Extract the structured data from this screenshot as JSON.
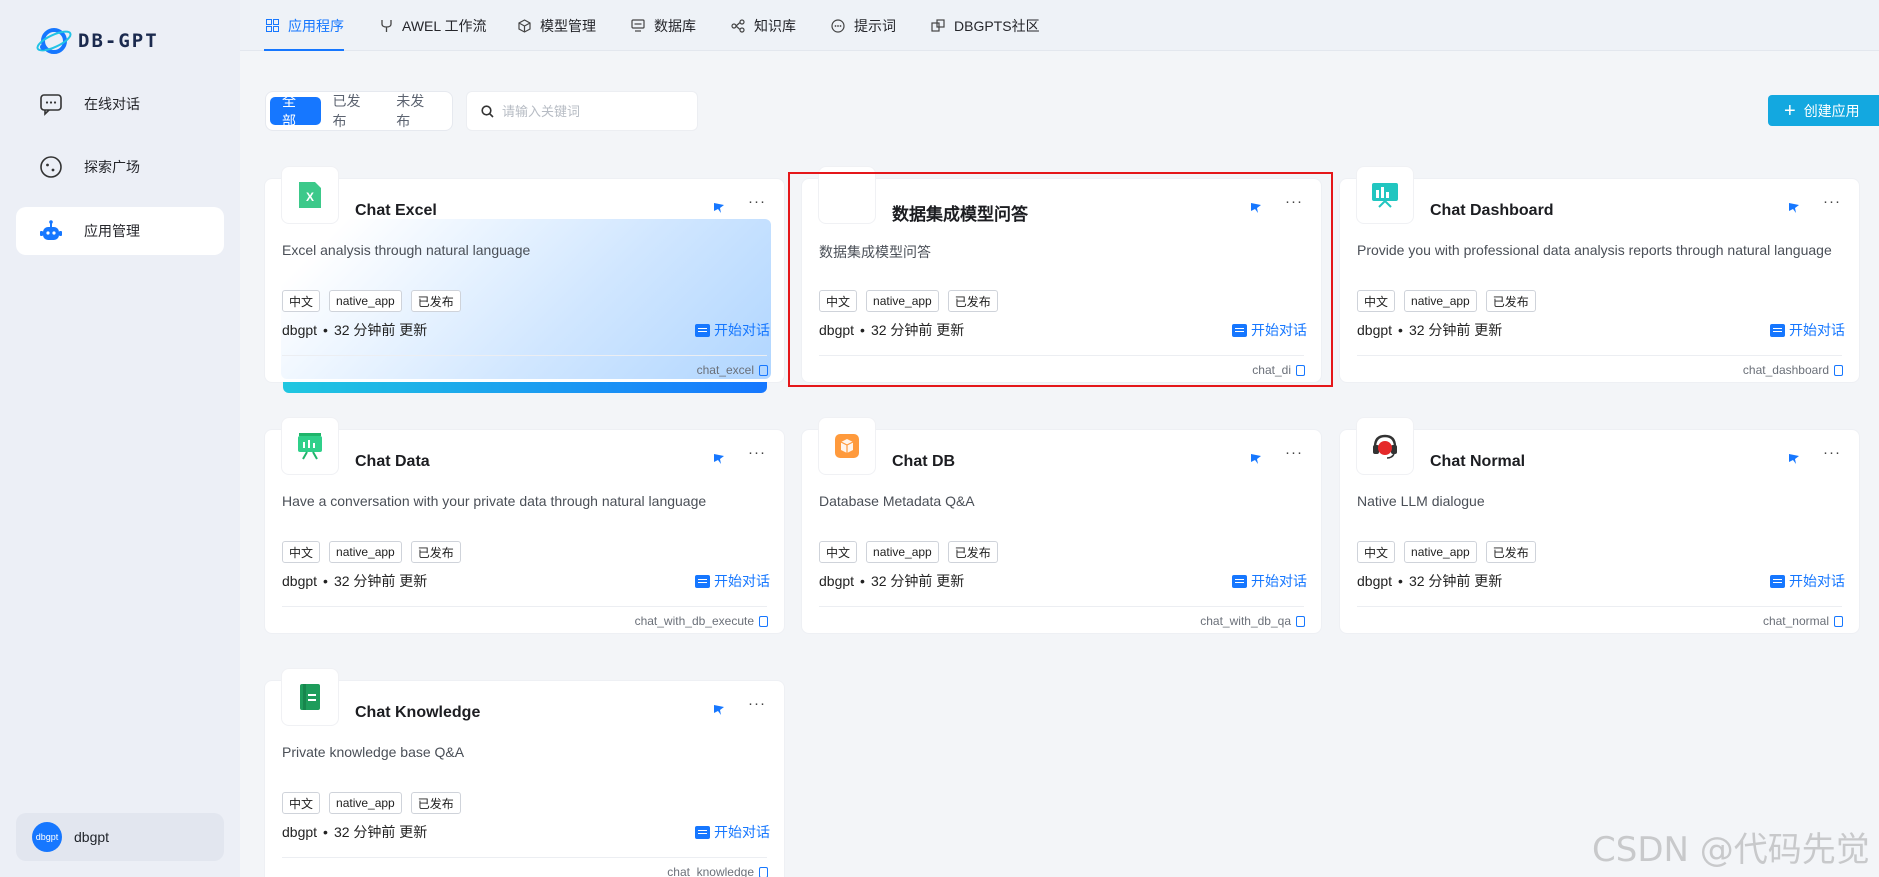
{
  "app": {
    "logo_text": "DB-GPT"
  },
  "sidebar": {
    "items": [
      {
        "label": "在线对话",
        "icon": "chat-bubble-icon"
      },
      {
        "label": "探索广场",
        "icon": "compass-icon"
      },
      {
        "label": "应用管理",
        "icon": "robot-icon",
        "active": true
      }
    ],
    "user": {
      "avatar_text": "dbgpt",
      "name": "dbgpt"
    }
  },
  "tabs": [
    {
      "label": "应用程序",
      "icon": "grid-icon",
      "active": true
    },
    {
      "label": "AWEL 工作流",
      "icon": "flow-icon"
    },
    {
      "label": "模型管理",
      "icon": "cube-icon"
    },
    {
      "label": "数据库",
      "icon": "database-icon"
    },
    {
      "label": "知识库",
      "icon": "graph-icon"
    },
    {
      "label": "提示词",
      "icon": "prompt-icon"
    },
    {
      "label": "DBGPTS社区",
      "icon": "community-icon"
    }
  ],
  "filters": {
    "segments": [
      "全部",
      "已发布",
      "未发布"
    ],
    "active_segment": "全部",
    "search_placeholder": "请输入关键词"
  },
  "create_button": "创建应用",
  "cards": [
    {
      "title": "Chat Excel",
      "desc": "Excel analysis through natural language",
      "tags": [
        "中文",
        "native_app",
        "已发布"
      ],
      "owner": "dbgpt",
      "updated": "32 分钟前 更新",
      "start": "开始对话",
      "code": "chat_excel",
      "icon": "excel-icon"
    },
    {
      "title": "数据集成模型问答",
      "desc": "数据集成模型问答",
      "tags": [
        "中文",
        "native_app",
        "已发布"
      ],
      "owner": "dbgpt",
      "updated": "32 分钟前 更新",
      "start": "开始对话",
      "code": "chat_di",
      "icon": "blank-icon"
    },
    {
      "title": "Chat Dashboard",
      "desc": "Provide you with professional data analysis reports through natural language",
      "tags": [
        "中文",
        "native_app",
        "已发布"
      ],
      "owner": "dbgpt",
      "updated": "32 分钟前 更新",
      "start": "开始对话",
      "code": "chat_dashboard",
      "icon": "dashboard-icon"
    },
    {
      "title": "Chat Data",
      "desc": "Have a conversation with your private data through natural language",
      "tags": [
        "中文",
        "native_app",
        "已发布"
      ],
      "owner": "dbgpt",
      "updated": "32 分钟前 更新",
      "start": "开始对话",
      "code": "chat_with_db_execute",
      "icon": "presentation-icon"
    },
    {
      "title": "Chat DB",
      "desc": "Database Metadata Q&A",
      "tags": [
        "中文",
        "native_app",
        "已发布"
      ],
      "owner": "dbgpt",
      "updated": "32 分钟前 更新",
      "start": "开始对话",
      "code": "chat_with_db_qa",
      "icon": "db-box-icon"
    },
    {
      "title": "Chat Normal",
      "desc": "Native LLM dialogue",
      "tags": [
        "中文",
        "native_app",
        "已发布"
      ],
      "owner": "dbgpt",
      "updated": "32 分钟前 更新",
      "start": "开始对话",
      "code": "chat_normal",
      "icon": "headset-icon"
    },
    {
      "title": "Chat Knowledge",
      "desc": "Private knowledge base Q&A",
      "tags": [
        "中文",
        "native_app",
        "已发布"
      ],
      "owner": "dbgpt",
      "updated": "32 分钟前 更新",
      "start": "开始对话",
      "code": "chat_knowledge",
      "icon": "book-icon"
    }
  ],
  "watermark": "CSDN @代码先觉",
  "colors": {
    "accent": "#1677ff",
    "create_button": "#13a8e0",
    "highlight": "#e5171a"
  }
}
